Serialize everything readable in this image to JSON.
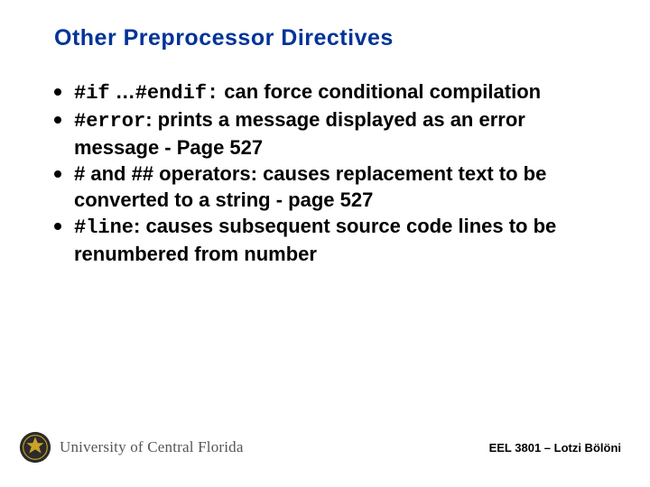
{
  "title": "Other Preprocessor Directives",
  "bullets": [
    {
      "code1": "#if",
      "mid": " …",
      "code2": "#endif:",
      "rest": " can force conditional compilation"
    },
    {
      "code1": "#error",
      "rest": ": prints a message displayed as an error message - Page 527"
    },
    {
      "rest": "# and ## operators: causes replacement text to be converted to a string - page 527"
    },
    {
      "code1": "#line",
      "rest": ": causes subsequent source code lines to be renumbered from number"
    }
  ],
  "footer": {
    "university": "University of Central Florida",
    "course": "EEL 3801 – Lotzi Bölöni"
  }
}
